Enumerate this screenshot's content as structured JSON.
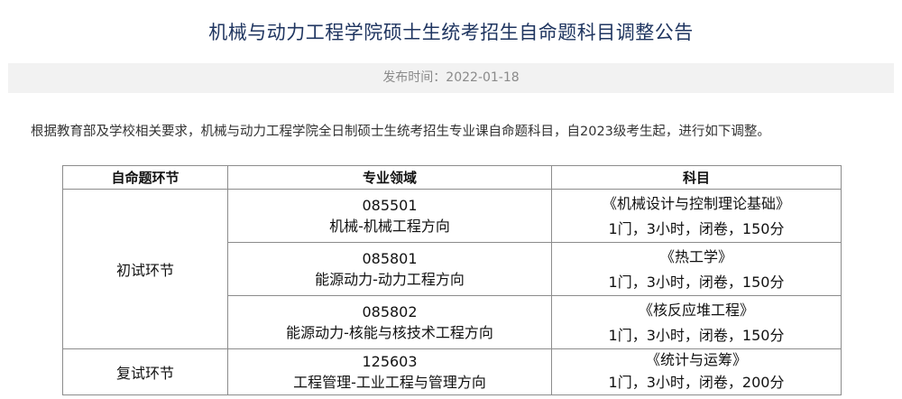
{
  "title": "机械与动力工程学院硕士生统考招生自命题科目调整公告",
  "publish": "发布时间：2022-01-18",
  "intro": "根据教育部及学校相关要求，机械与动力工程学院全日制硕士生统考招生专业课自命题科目，自2023级考生起，进行如下调整。",
  "table": {
    "headers": [
      "自命题环节",
      "专业领域",
      "科目"
    ],
    "rows": [
      {
        "stage": "初试环节",
        "code": "085501",
        "field": "机械-机械工程方向",
        "subject": "《机械设计与控制理论基础》",
        "detail": "1门，3小时，闭卷，150分"
      },
      {
        "code": "085801",
        "field": "能源动力-动力工程方向",
        "subject": "《热工学》",
        "detail": "1门，3小时，闭卷，150分"
      },
      {
        "code": "085802",
        "field": "能源动力-核能与核技术工程方向",
        "subject": "《核反应堆工程》",
        "detail": "1门，3小时，闭卷，150分"
      },
      {
        "stage": "复试环节",
        "code": "125603",
        "field": "工程管理-工业工程与管理方向",
        "subject": "《统计与运筹》",
        "detail": "1门，3小时，闭卷，200分"
      }
    ]
  }
}
